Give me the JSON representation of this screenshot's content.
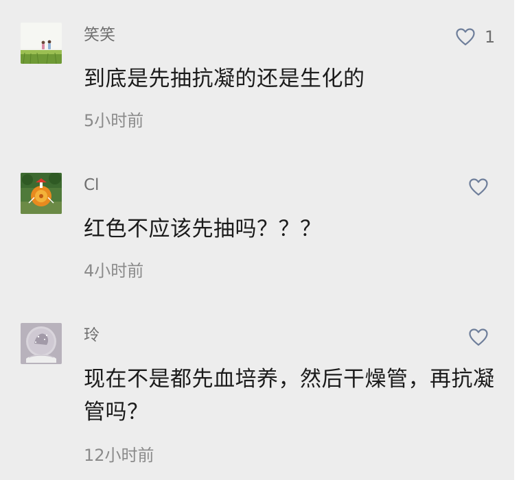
{
  "comments": [
    {
      "user": "笑笑",
      "text": "到底是先抽抗凝的还是生化的",
      "time": "5小时前",
      "likes": "1",
      "avatar_icon": "field-kids-avatar"
    },
    {
      "user": "Cl",
      "text": "红色不应该先抽吗？？？",
      "time": "4小时前",
      "likes": "",
      "avatar_icon": "outdoor-toy-avatar"
    },
    {
      "user": "玲",
      "text": "现在不是都先血培养，然后干燥管，再抗凝管吗？",
      "time": "12小时前",
      "likes": "",
      "avatar_icon": "snow-globe-avatar"
    }
  ],
  "colors": {
    "background": "#ededed",
    "username": "#6e6e6e",
    "text": "#1b1b1b",
    "time": "#8a8a8a",
    "heart": "#6e7e9a"
  }
}
